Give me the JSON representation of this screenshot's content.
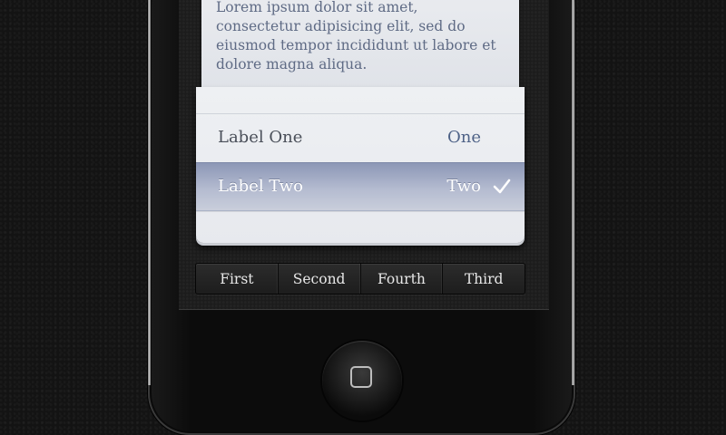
{
  "note": {
    "text": "Lorem ipsum dolor sit amet, consectetur adipisicing elit, sed do eiusmod tempor incididunt ut labore et dolore magna aliqua."
  },
  "picker": {
    "rows": [
      {
        "label": "Label One",
        "value": "One",
        "selected": false
      },
      {
        "label": "Label Two",
        "value": "Two",
        "selected": true
      }
    ]
  },
  "segmented": {
    "items": [
      "First",
      "Second",
      "Fourth",
      "Third"
    ]
  },
  "colors": {
    "selected_row": "#9aa3bf",
    "value_text": "#4e6287",
    "background": "#131313"
  },
  "icons": {
    "checkmark": "checkmark-icon",
    "home": "home-button-icon"
  }
}
